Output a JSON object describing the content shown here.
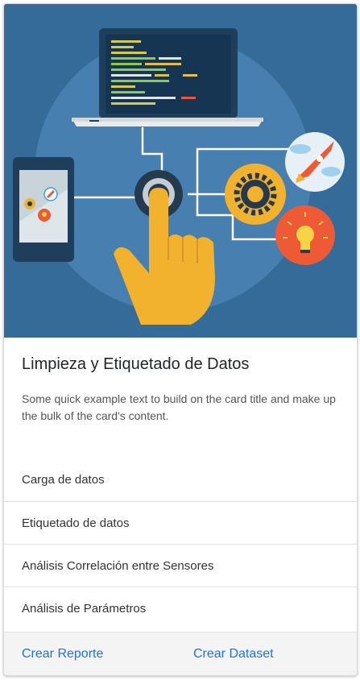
{
  "card": {
    "title": "Limpieza y Etiquetado de Datos",
    "text": "Some quick example text to build on the card title and make up the bulk of the card's content.",
    "items": [
      {
        "label": "Carga de datos"
      },
      {
        "label": "Etiquetado de datos"
      },
      {
        "label": "Análisis Correlación entre Sensores"
      },
      {
        "label": "Análisis de Parámetros"
      }
    ],
    "links": [
      {
        "label": "Crear Reporte"
      },
      {
        "label": "Crear Dataset"
      }
    ]
  },
  "colors": {
    "image_background": "#346b98",
    "circle": "#4780b0",
    "accent_yellow": "#f2b22d",
    "accent_orange": "#ef5a36",
    "link": "#1a73e8"
  },
  "icons": [
    "laptop-icon",
    "phone-icon",
    "gear-icon",
    "rocket-icon",
    "lightbulb-icon",
    "touch-hand-icon"
  ]
}
